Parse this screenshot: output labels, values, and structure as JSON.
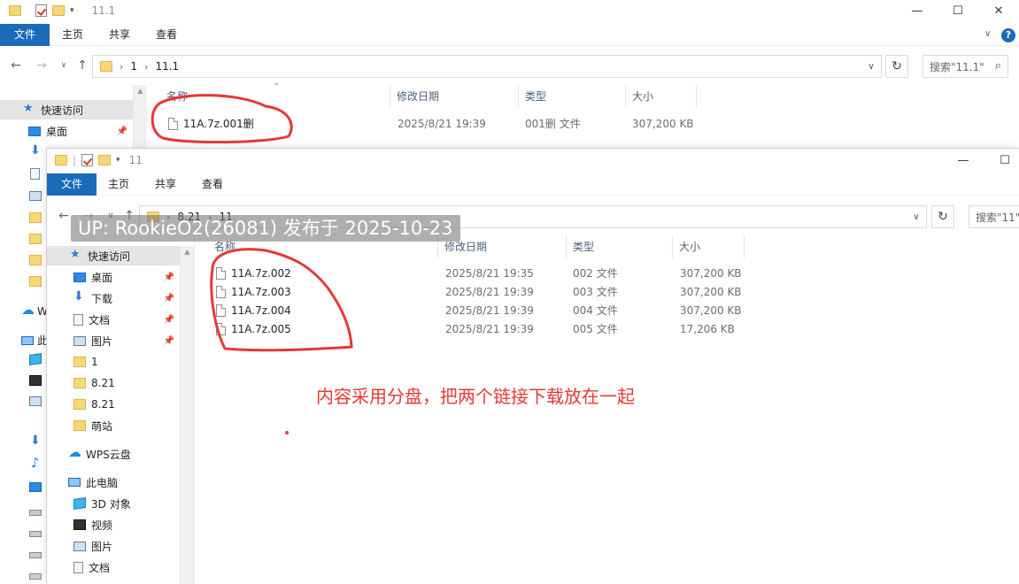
{
  "back_window": {
    "title": "11.1",
    "tabs": [
      "文件",
      "主页",
      "共享",
      "查看"
    ],
    "breadcrumb": [
      "1",
      "11.1"
    ],
    "search_placeholder": "搜索\"11.1\"",
    "columns": [
      "名称",
      "修改日期",
      "类型",
      "大小"
    ],
    "files": [
      {
        "name": "11A.7z.001删",
        "date": "2025/8/21 19:39",
        "type": "001删 文件",
        "size": "307,200 KB"
      }
    ],
    "nav": {
      "quick_access": "快速访问",
      "desktop": "桌面"
    },
    "left_partial": [
      "W",
      "此"
    ]
  },
  "front_window": {
    "title": "11",
    "tabs": [
      "文件",
      "主页",
      "共享",
      "查看"
    ],
    "breadcrumb": [
      "8.21",
      "11"
    ],
    "search_placeholder": "搜索\"11\"",
    "columns": [
      "名称",
      "修改日期",
      "类型",
      "大小"
    ],
    "files": [
      {
        "name": "11A.7z.002",
        "date": "2025/8/21 19:35",
        "type": "002 文件",
        "size": "307,200 KB"
      },
      {
        "name": "11A.7z.003",
        "date": "2025/8/21 19:39",
        "type": "003 文件",
        "size": "307,200 KB"
      },
      {
        "name": "11A.7z.004",
        "date": "2025/8/21 19:39",
        "type": "004 文件",
        "size": "307,200 KB"
      },
      {
        "name": "11A.7z.005",
        "date": "2025/8/21 19:39",
        "type": "005 文件",
        "size": "17,206 KB"
      }
    ],
    "nav": [
      {
        "label": "快速访问",
        "icon": "star-icon"
      },
      {
        "label": "桌面",
        "icon": "desktop-icon",
        "pinned": true
      },
      {
        "label": "下载",
        "icon": "download-icon",
        "pinned": true
      },
      {
        "label": "文档",
        "icon": "document-icon",
        "pinned": true
      },
      {
        "label": "图片",
        "icon": "pictures-icon",
        "pinned": true
      },
      {
        "label": "1",
        "icon": "folder-icon"
      },
      {
        "label": "8.21",
        "icon": "folder-icon"
      },
      {
        "label": "8.21",
        "icon": "folder-icon"
      },
      {
        "label": "萌站",
        "icon": "folder-icon"
      },
      {
        "label": "WPS云盘",
        "icon": "cloud-icon"
      },
      {
        "label": "此电脑",
        "icon": "computer-icon"
      },
      {
        "label": "3D 对象",
        "icon": "3d-objects-icon"
      },
      {
        "label": "视频",
        "icon": "video-icon"
      },
      {
        "label": "图片",
        "icon": "pictures-icon"
      },
      {
        "label": "文档",
        "icon": "document-icon"
      }
    ]
  },
  "watermark": "UP: RookieO2(26081) 发布于 2025-10-23",
  "annotation": "内容采用分盘，把两个链接下载放在一起",
  "colors": {
    "accent": "#1a6bb8",
    "annotation_red": "#e53935",
    "selected_nav": "#e5e5e5"
  }
}
